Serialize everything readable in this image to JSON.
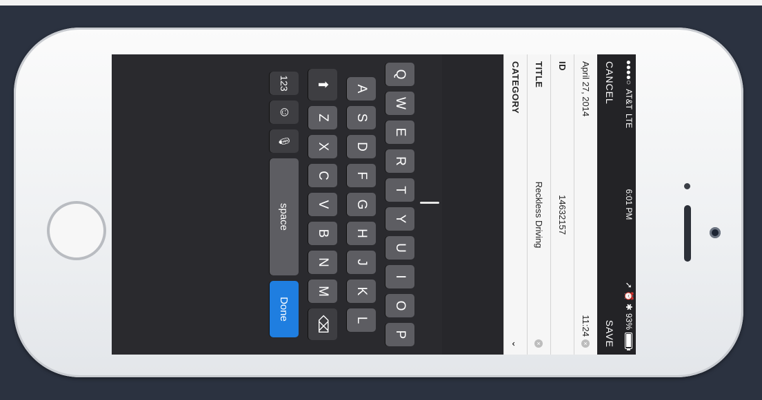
{
  "status": {
    "dots": "●●●●○",
    "carrier": "AT&T",
    "network": "LTE",
    "time": "6:01 PM",
    "icons": "➚ ⏰ ✱",
    "battery": "93%",
    "battery_fraction": 0.93
  },
  "nav": {
    "cancel": "CANCEL",
    "save": "SAVE"
  },
  "form": {
    "date": "April 27, 2014",
    "time": "11:24",
    "id_label": "ID",
    "id_value": "14632157",
    "title_label": "TITLE",
    "title_value": "Reckless Driving",
    "clear": "×",
    "category_label": "CATEGORY",
    "chevron": "⌄"
  },
  "keyboard": {
    "row1": [
      "Q",
      "W",
      "E",
      "R",
      "T",
      "Y",
      "U",
      "I",
      "O",
      "P"
    ],
    "row2": [
      "A",
      "S",
      "D",
      "F",
      "G",
      "H",
      "J",
      "K",
      "L"
    ],
    "row3": [
      "Z",
      "X",
      "C",
      "V",
      "B",
      "N",
      "M"
    ],
    "shift": "⬆",
    "delete": "⌫",
    "numbers": "123",
    "emoji": "☺",
    "mic": "🎙",
    "space": "space",
    "done": "Done"
  }
}
